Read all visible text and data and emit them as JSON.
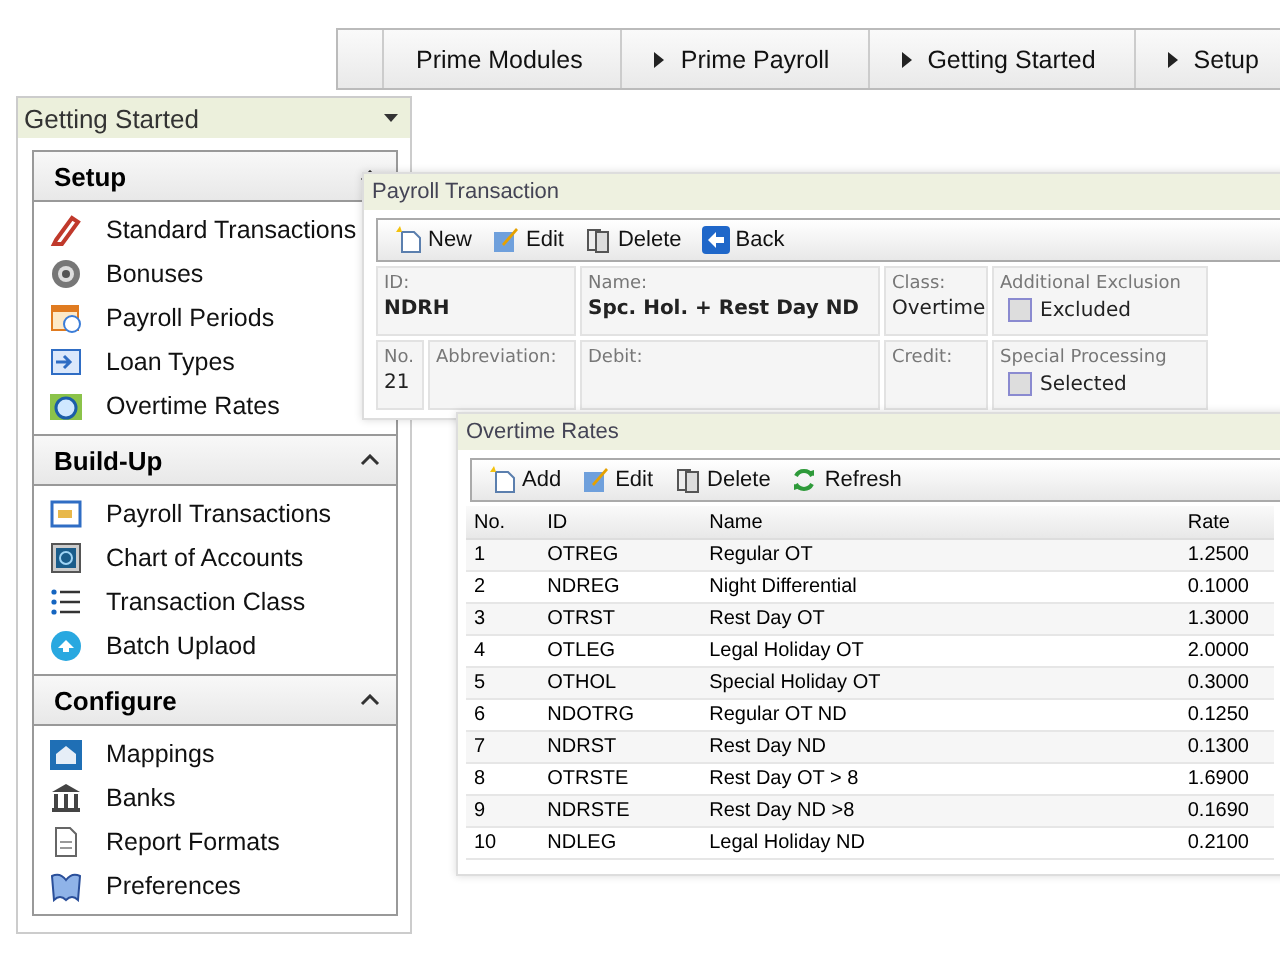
{
  "breadcrumb": [
    {
      "label": "Prime Modules",
      "kind": "root"
    },
    {
      "label": "Prime Payroll",
      "kind": "step"
    },
    {
      "label": "Getting Started",
      "kind": "step"
    },
    {
      "label": "Setup",
      "kind": "step"
    }
  ],
  "sidebar": {
    "title": "Getting Started",
    "sections": [
      {
        "title": "Setup",
        "expanded": true,
        "items": [
          {
            "label": "Standard Transactions"
          },
          {
            "label": "Bonuses"
          },
          {
            "label": "Payroll Periods"
          },
          {
            "label": "Loan Types"
          },
          {
            "label": "Overtime Rates"
          }
        ]
      },
      {
        "title": "Build-Up",
        "expanded": true,
        "items": [
          {
            "label": "Payroll Transactions"
          },
          {
            "label": "Chart of Accounts"
          },
          {
            "label": "Transaction Class"
          },
          {
            "label": "Batch Uplaod"
          }
        ]
      },
      {
        "title": "Configure",
        "expanded": true,
        "items": [
          {
            "label": "Mappings"
          },
          {
            "label": "Banks"
          },
          {
            "label": "Report Formats"
          },
          {
            "label": "Preferences"
          }
        ]
      }
    ]
  },
  "payroll_transaction": {
    "title": "Payroll Transaction",
    "toolbar": [
      {
        "label": "New",
        "kind": "new"
      },
      {
        "label": "Edit",
        "kind": "edit"
      },
      {
        "label": "Delete",
        "kind": "delete"
      },
      {
        "label": "Back",
        "kind": "back"
      }
    ],
    "fields": [
      {
        "kind": "text",
        "label": "ID:",
        "value": "NDRH",
        "bold": true
      },
      {
        "kind": "text",
        "label": "Name:",
        "value": "Spc. Hol. + Rest Day ND",
        "bold": true
      },
      {
        "kind": "text",
        "label": "Class:",
        "value": "Overtime",
        "bold": false
      },
      {
        "kind": "check",
        "label": "Additional Exclusion",
        "option": "Excluded",
        "checked": false
      },
      {
        "kind": "text",
        "label": "No.",
        "value": "21",
        "bold": false
      },
      {
        "kind": "text",
        "label": "Abbreviation:"
      },
      {
        "kind": "text",
        "label": "Debit:"
      },
      {
        "kind": "text",
        "label": "Credit:"
      },
      {
        "kind": "check",
        "label": "Special Processing",
        "option": "Selected",
        "checked": false
      }
    ]
  },
  "overtime_rates": {
    "title": "Overtime Rates",
    "toolbar": [
      {
        "label": "Add",
        "kind": "new"
      },
      {
        "label": "Edit",
        "kind": "edit"
      },
      {
        "label": "Delete",
        "kind": "delete"
      },
      {
        "label": "Refresh",
        "kind": "refresh"
      }
    ],
    "columns": [
      "No.",
      "ID",
      "Name",
      "Rate"
    ],
    "rows": [
      [
        "1",
        "OTREG",
        "Regular OT",
        "1.2500"
      ],
      [
        "2",
        "NDREG",
        "Night Differential",
        "0.1000"
      ],
      [
        "3",
        "OTRST",
        "Rest Day OT",
        "1.3000"
      ],
      [
        "4",
        "OTLEG",
        "Legal Holiday OT",
        "2.0000"
      ],
      [
        "5",
        "OTHOL",
        "Special Holiday OT",
        "0.3000"
      ],
      [
        "6",
        "NDOTRG",
        "Regular OT ND",
        "0.1250"
      ],
      [
        "7",
        "NDRST",
        "Rest Day ND",
        "0.1300"
      ],
      [
        "8",
        "OTRSTE",
        "Rest Day OT > 8",
        "1.6900"
      ],
      [
        "9",
        "NDRSTE",
        "Rest Day ND >8",
        "0.1690"
      ],
      [
        "10",
        "NDLEG",
        "Legal Holiday ND",
        "0.2100"
      ]
    ]
  }
}
